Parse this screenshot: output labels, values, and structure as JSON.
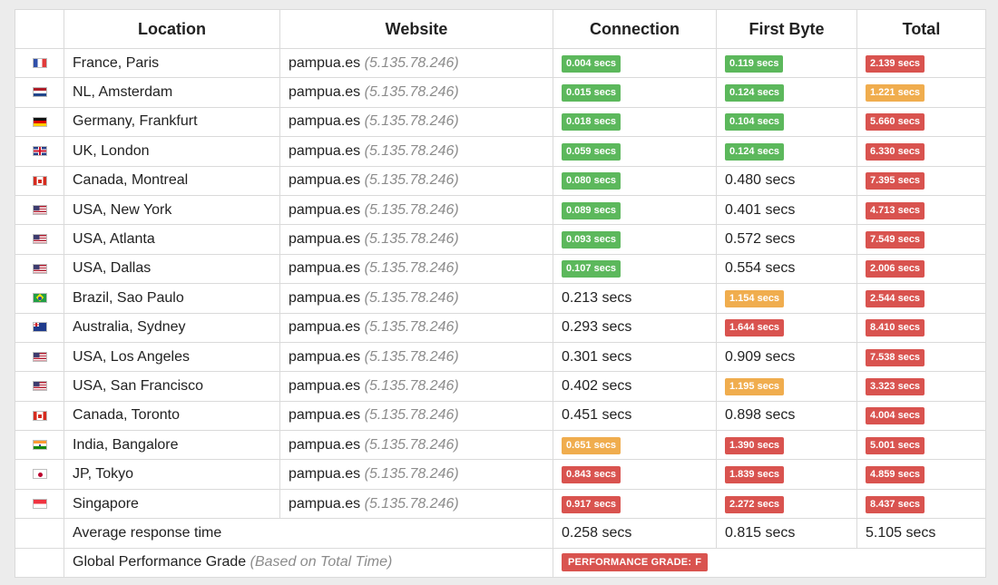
{
  "headers": {
    "location": "Location",
    "website": "Website",
    "connection": "Connection",
    "first_byte": "First Byte",
    "total": "Total"
  },
  "rows": [
    {
      "flag": "fr",
      "location": "France, Paris",
      "site": "pampua.es",
      "ip": "(5.135.78.246)",
      "connection": {
        "text": "0.004 secs",
        "status": "green"
      },
      "first_byte": {
        "text": "0.119 secs",
        "status": "green"
      },
      "total": {
        "text": "2.139 secs",
        "status": "red"
      }
    },
    {
      "flag": "nl",
      "location": "NL, Amsterdam",
      "site": "pampua.es",
      "ip": "(5.135.78.246)",
      "connection": {
        "text": "0.015 secs",
        "status": "green"
      },
      "first_byte": {
        "text": "0.124 secs",
        "status": "green"
      },
      "total": {
        "text": "1.221 secs",
        "status": "orange"
      }
    },
    {
      "flag": "de",
      "location": "Germany, Frankfurt",
      "site": "pampua.es",
      "ip": "(5.135.78.246)",
      "connection": {
        "text": "0.018 secs",
        "status": "green"
      },
      "first_byte": {
        "text": "0.104 secs",
        "status": "green"
      },
      "total": {
        "text": "5.660 secs",
        "status": "red"
      }
    },
    {
      "flag": "uk",
      "location": "UK, London",
      "site": "pampua.es",
      "ip": "(5.135.78.246)",
      "connection": {
        "text": "0.059 secs",
        "status": "green"
      },
      "first_byte": {
        "text": "0.124 secs",
        "status": "green"
      },
      "total": {
        "text": "6.330 secs",
        "status": "red"
      }
    },
    {
      "flag": "ca",
      "location": "Canada, Montreal",
      "site": "pampua.es",
      "ip": "(5.135.78.246)",
      "connection": {
        "text": "0.080 secs",
        "status": "green"
      },
      "first_byte": {
        "text": "0.480 secs",
        "status": "plain"
      },
      "total": {
        "text": "7.395 secs",
        "status": "red"
      }
    },
    {
      "flag": "us",
      "location": "USA, New York",
      "site": "pampua.es",
      "ip": "(5.135.78.246)",
      "connection": {
        "text": "0.089 secs",
        "status": "green"
      },
      "first_byte": {
        "text": "0.401 secs",
        "status": "plain"
      },
      "total": {
        "text": "4.713 secs",
        "status": "red"
      }
    },
    {
      "flag": "us",
      "location": "USA, Atlanta",
      "site": "pampua.es",
      "ip": "(5.135.78.246)",
      "connection": {
        "text": "0.093 secs",
        "status": "green"
      },
      "first_byte": {
        "text": "0.572 secs",
        "status": "plain"
      },
      "total": {
        "text": "7.549 secs",
        "status": "red"
      }
    },
    {
      "flag": "us",
      "location": "USA, Dallas",
      "site": "pampua.es",
      "ip": "(5.135.78.246)",
      "connection": {
        "text": "0.107 secs",
        "status": "green"
      },
      "first_byte": {
        "text": "0.554 secs",
        "status": "plain"
      },
      "total": {
        "text": "2.006 secs",
        "status": "red"
      }
    },
    {
      "flag": "br",
      "location": "Brazil, Sao Paulo",
      "site": "pampua.es",
      "ip": "(5.135.78.246)",
      "connection": {
        "text": "0.213 secs",
        "status": "plain"
      },
      "first_byte": {
        "text": "1.154 secs",
        "status": "orange"
      },
      "total": {
        "text": "2.544 secs",
        "status": "red"
      }
    },
    {
      "flag": "au",
      "location": "Australia, Sydney",
      "site": "pampua.es",
      "ip": "(5.135.78.246)",
      "connection": {
        "text": "0.293 secs",
        "status": "plain"
      },
      "first_byte": {
        "text": "1.644 secs",
        "status": "red"
      },
      "total": {
        "text": "8.410 secs",
        "status": "red"
      }
    },
    {
      "flag": "us",
      "location": "USA, Los Angeles",
      "site": "pampua.es",
      "ip": "(5.135.78.246)",
      "connection": {
        "text": "0.301 secs",
        "status": "plain"
      },
      "first_byte": {
        "text": "0.909 secs",
        "status": "plain"
      },
      "total": {
        "text": "7.538 secs",
        "status": "red"
      }
    },
    {
      "flag": "us",
      "location": "USA, San Francisco",
      "site": "pampua.es",
      "ip": "(5.135.78.246)",
      "connection": {
        "text": "0.402 secs",
        "status": "plain"
      },
      "first_byte": {
        "text": "1.195 secs",
        "status": "orange"
      },
      "total": {
        "text": "3.323 secs",
        "status": "red"
      }
    },
    {
      "flag": "ca",
      "location": "Canada, Toronto",
      "site": "pampua.es",
      "ip": "(5.135.78.246)",
      "connection": {
        "text": "0.451 secs",
        "status": "plain"
      },
      "first_byte": {
        "text": "0.898 secs",
        "status": "plain"
      },
      "total": {
        "text": "4.004 secs",
        "status": "red"
      }
    },
    {
      "flag": "in",
      "location": "India, Bangalore",
      "site": "pampua.es",
      "ip": "(5.135.78.246)",
      "connection": {
        "text": "0.651 secs",
        "status": "orange"
      },
      "first_byte": {
        "text": "1.390 secs",
        "status": "red"
      },
      "total": {
        "text": "5.001 secs",
        "status": "red"
      }
    },
    {
      "flag": "jp",
      "location": "JP, Tokyo",
      "site": "pampua.es",
      "ip": "(5.135.78.246)",
      "connection": {
        "text": "0.843 secs",
        "status": "red"
      },
      "first_byte": {
        "text": "1.839 secs",
        "status": "red"
      },
      "total": {
        "text": "4.859 secs",
        "status": "red"
      }
    },
    {
      "flag": "sg",
      "location": "Singapore",
      "site": "pampua.es",
      "ip": "(5.135.78.246)",
      "connection": {
        "text": "0.917 secs",
        "status": "red"
      },
      "first_byte": {
        "text": "2.272 secs",
        "status": "red"
      },
      "total": {
        "text": "8.437 secs",
        "status": "red"
      }
    }
  ],
  "average": {
    "label": "Average response time",
    "connection": "0.258 secs",
    "first_byte": "0.815 secs",
    "total": "5.105 secs"
  },
  "grade": {
    "label": "Global Performance Grade",
    "note": "(Based on Total Time)",
    "badge_label": "PERFORMANCE GRADE:",
    "badge_value": "F"
  },
  "colors": {
    "green": "#5cb85c",
    "orange": "#f0ad4e",
    "red": "#d9534f"
  }
}
